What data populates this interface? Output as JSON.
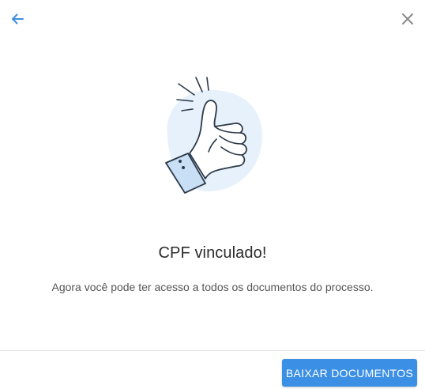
{
  "header": {
    "back_icon": "arrow-left-icon",
    "close_icon": "close-icon"
  },
  "illustration": {
    "icon": "thumbs-up-icon"
  },
  "content": {
    "title": "CPF vinculado!",
    "message": "Agora você pode ter acesso a todos os documentos do processo."
  },
  "footer": {
    "primary_label": "BAIXAR DOCUMENTOS"
  },
  "colors": {
    "accent": "#3b8fe4",
    "icon_gray": "#8a8a8a",
    "illustration_bg": "#e6f1fb",
    "cuff": "#c8dff5"
  }
}
